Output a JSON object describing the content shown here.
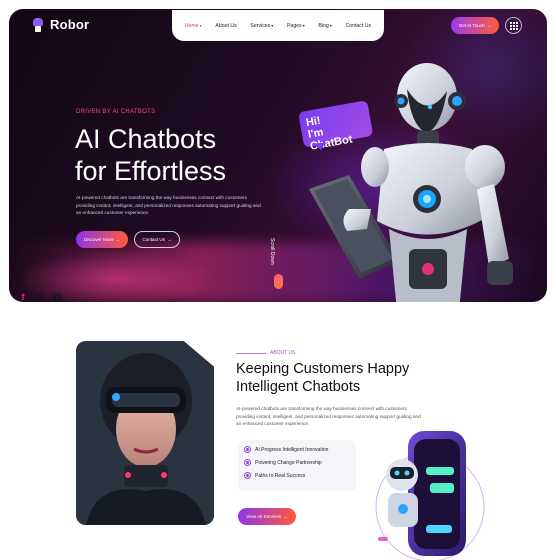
{
  "brand": {
    "name": "Robor"
  },
  "nav": {
    "items": [
      {
        "label": "Home",
        "has_dropdown": true,
        "active": true
      },
      {
        "label": "About Us",
        "has_dropdown": false
      },
      {
        "label": "Services",
        "has_dropdown": true
      },
      {
        "label": "Pages",
        "has_dropdown": true
      },
      {
        "label": "Blog",
        "has_dropdown": true
      },
      {
        "label": "Contact Us",
        "has_dropdown": false
      }
    ],
    "cta_label": "Get In Touch",
    "arrow": "→",
    "chevron": "▾"
  },
  "hero": {
    "eyebrow": "DRIVEN BY AI CHATBOTS",
    "title_line1": "AI Chatbots",
    "title_line2": "for Effortless",
    "description": "AI-powered chatbots are transforming the way businesses connect with customers providing instant, intelligent, and personalized responses automating support guiding and an enhanced customer experience.",
    "primary_button": "Discover More",
    "secondary_button": "Contact Us",
    "bubble_line1": "Hi!",
    "bubble_line2": "I'm ChatBot",
    "scroll_label": "Scroll Down"
  },
  "social": {
    "facebook": "f",
    "x": "𝕏"
  },
  "about": {
    "eyebrow": "ABOUT US",
    "title_line1": "Keeping Customers Happy",
    "title_line2": "Intelligent Chatbots",
    "description": "AI-powered chatbots are transforming the way businesses connect with customers providing instant, intelligent, and personalized responses automating support guiding and an enhanced customer experience.",
    "features": [
      "AI Progress Intelligent Innovation",
      "Powering Change Partnership",
      "Paths to Real Success"
    ],
    "button": "View All Services"
  },
  "colors": {
    "accent_pink": "#f0488e",
    "accent_purple": "#8f34e8",
    "accent_orange": "#ff5a3c",
    "hero_bg": "#1e0a22"
  }
}
